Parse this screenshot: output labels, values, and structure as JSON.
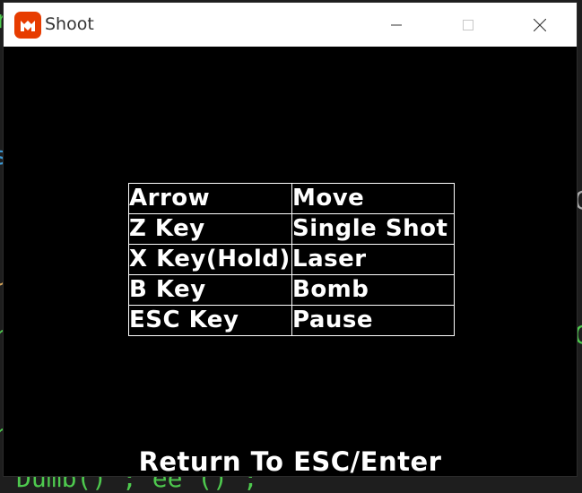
{
  "window": {
    "title": "Shoot",
    "icon": "monogame-logo-icon",
    "controls": {
      "minimize": "minimize-icon",
      "maximize": "maximize-icon",
      "close": "close-icon"
    }
  },
  "controls_table": {
    "rows": [
      {
        "key": "Arrow",
        "action": "Move"
      },
      {
        "key": "Z Key",
        "action": "Single Shot"
      },
      {
        "key": "X Key(Hold)",
        "action": "Laser"
      },
      {
        "key": "B Key",
        "action": "Bomb"
      },
      {
        "key": "ESC Key",
        "action": "Pause"
      }
    ]
  },
  "footer": {
    "return_text": "Return To ESC/Enter"
  },
  "background": {
    "bottom_fragment": "Dumb() ; ee () ;"
  },
  "colors": {
    "brand_orange": "#e73c00",
    "editor_green": "#4ec94e",
    "editor_orange": "#d7a55a",
    "editor_blue": "#3c9ad6",
    "window_bg": "#000000",
    "titlebar_bg": "#ffffff"
  }
}
